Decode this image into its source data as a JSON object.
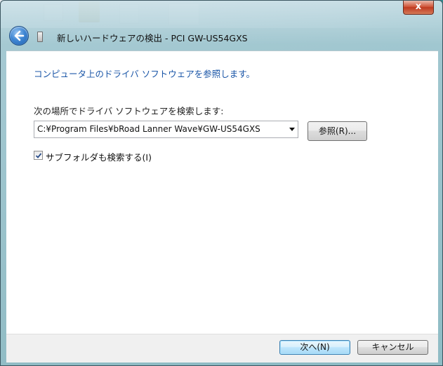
{
  "window": {
    "title": "新しいハードウェアの検出 - PCI GW-US54GXS",
    "close_glyph": "x"
  },
  "content": {
    "instruction": "コンピュータ上のドライバ ソフトウェアを参照します。",
    "path_label": "次の場所でドライバ ソフトウェアを検索します:",
    "path_value": "C:¥Program Files¥bRoad Lanner Wave¥GW-US54GXS",
    "browse_label": "参照(R)...",
    "include_subfolders_label": "サブフォルダも検索する(I)",
    "include_subfolders_checked": true
  },
  "footer": {
    "next_label": "次へ(N)",
    "cancel_label": "キャンセル"
  },
  "icons": {
    "back": "back-arrow-icon",
    "wizard": "hardware-wizard-icon",
    "dropdown": "chevron-down-icon",
    "check": "checkmark-icon"
  },
  "colors": {
    "instruction_text": "#1c57a8",
    "default_button_border": "#3c7fb1",
    "close_button": "#c8462b"
  }
}
